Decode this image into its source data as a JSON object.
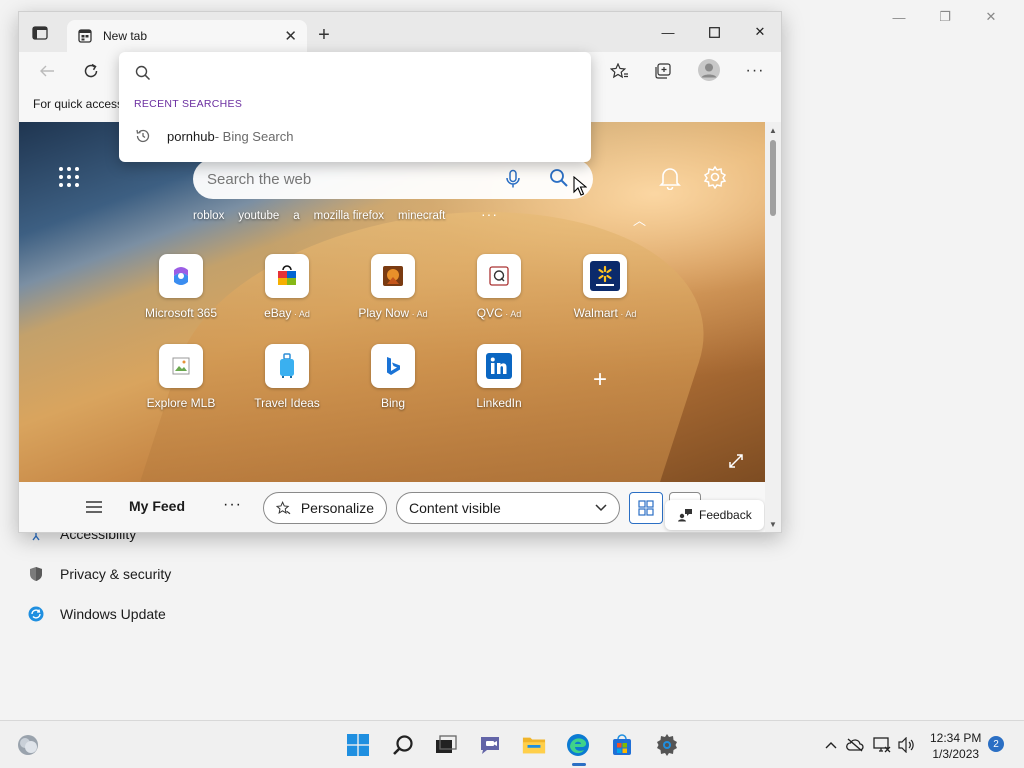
{
  "settings_bg": {
    "items": [
      {
        "label": "Accessibility",
        "icon": "accessibility-icon"
      },
      {
        "label": "Privacy & security",
        "icon": "shield-icon"
      },
      {
        "label": "Windows Update",
        "icon": "windows-update-icon"
      }
    ]
  },
  "browser": {
    "tab_title": "New tab",
    "favorites_bar_text": "For quick access",
    "address_dropdown": {
      "header": "RECENT SEARCHES",
      "items": [
        {
          "query": "pornhub",
          "source": " - Bing Search"
        }
      ]
    },
    "ntp": {
      "search_placeholder": "Search the web",
      "quick_searches": [
        "roblox",
        "youtube",
        "a",
        "mozilla firefox",
        "minecraft"
      ],
      "tiles": [
        {
          "label": "Microsoft 365",
          "ad": ""
        },
        {
          "label": "eBay",
          "ad": " · Ad"
        },
        {
          "label": "Play Now",
          "ad": " · Ad"
        },
        {
          "label": "QVC",
          "ad": " · Ad"
        },
        {
          "label": "Walmart",
          "ad": " · Ad"
        },
        {
          "label": "Explore MLB",
          "ad": ""
        },
        {
          "label": "Travel Ideas",
          "ad": ""
        },
        {
          "label": "Bing",
          "ad": ""
        },
        {
          "label": "LinkedIn",
          "ad": ""
        }
      ],
      "feed": {
        "title": "My Feed",
        "personalize": "Personalize",
        "content_select": "Content visible",
        "feedback": "Feedback"
      }
    }
  },
  "taskbar": {
    "time": "12:34 PM",
    "date": "1/3/2023",
    "notifications": "2"
  },
  "colors": {
    "accent": "#2b6fc4",
    "recent_header": "#6b2fa0"
  }
}
